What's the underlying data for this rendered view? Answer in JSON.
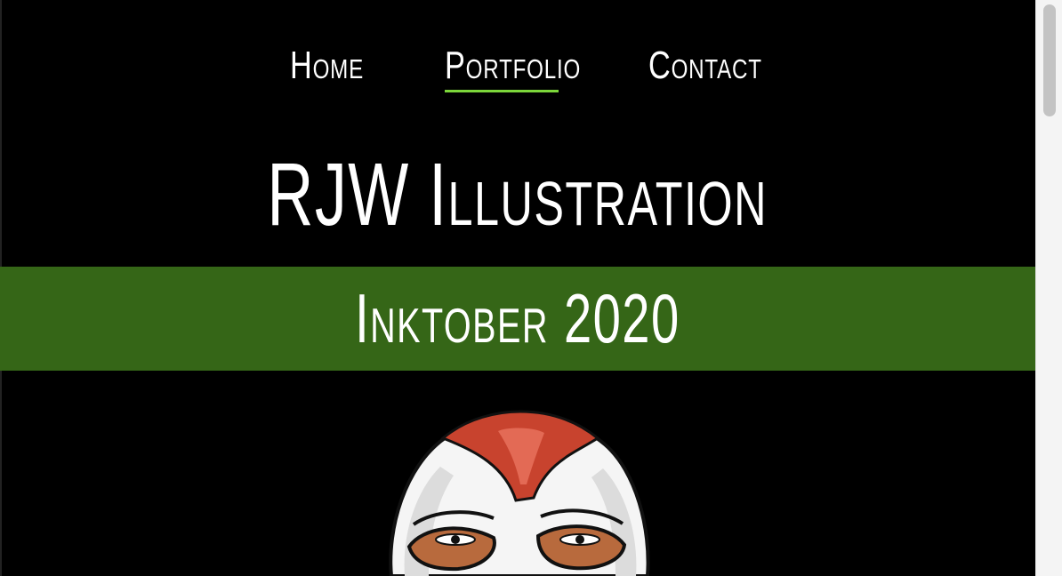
{
  "nav": {
    "items": [
      {
        "label": "Home"
      },
      {
        "label": "Portfolio",
        "active": true
      },
      {
        "label": "Contact"
      }
    ],
    "active_underline_color": "#7cd63a"
  },
  "header": {
    "title": "RJW Illustration"
  },
  "banner": {
    "title": "Inktober 2020",
    "background": "#356617"
  },
  "artwork": {
    "description_icon": "masked-face-illustration-icon"
  },
  "colors": {
    "page_background": "#000000",
    "text": "#ffffff",
    "accent": "#7cd63a",
    "banner": "#356617"
  }
}
